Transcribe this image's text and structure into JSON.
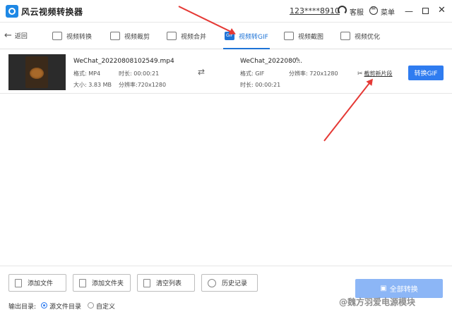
{
  "titlebar": {
    "app_title": "风云视频转换器",
    "user_phone": "123****8910",
    "service_label": "客服",
    "menu_label": "菜单",
    "min_glyph": "—",
    "close_glyph": "✕"
  },
  "nav": {
    "back_label": "返回",
    "tabs": [
      {
        "label": "视频转换",
        "icon": "video-convert-icon"
      },
      {
        "label": "视频裁剪",
        "icon": "video-crop-icon"
      },
      {
        "label": "视频合并",
        "icon": "video-merge-icon"
      },
      {
        "label": "视频转GIF",
        "icon": "gif-icon",
        "active": true
      },
      {
        "label": "视频截图",
        "icon": "screenshot-icon"
      },
      {
        "label": "视频优化",
        "icon": "optimize-icon"
      }
    ]
  },
  "file": {
    "name": "WeChat_20220808102549.mp4",
    "format_label": "格式: MP4",
    "duration_label": "时长: 00:00:21",
    "size_label": "大小: 3.83 MB",
    "resolution_label": "分辨率:720x1280",
    "output_name": "WeChat_2022080...",
    "output_format_label": "格式: GIF",
    "output_resolution_label": "分辨率: 720x1280",
    "output_duration_label": "时长: 00:00:21",
    "cut_label": "截剪新片段",
    "convert_label": "转换GIF"
  },
  "bottom": {
    "add_file": "添加文件",
    "add_folder": "添加文件夹",
    "clear_list": "清空列表",
    "history": "历史记录",
    "output_dir_label": "输出目录:",
    "source_dir": "源文件目录",
    "custom": "自定义",
    "convert_all": "全部转换"
  },
  "watermark": "@魏方羽爱电源模块",
  "colors": {
    "accent": "#2f7cf0",
    "annotation_arrow": "#e53935"
  }
}
